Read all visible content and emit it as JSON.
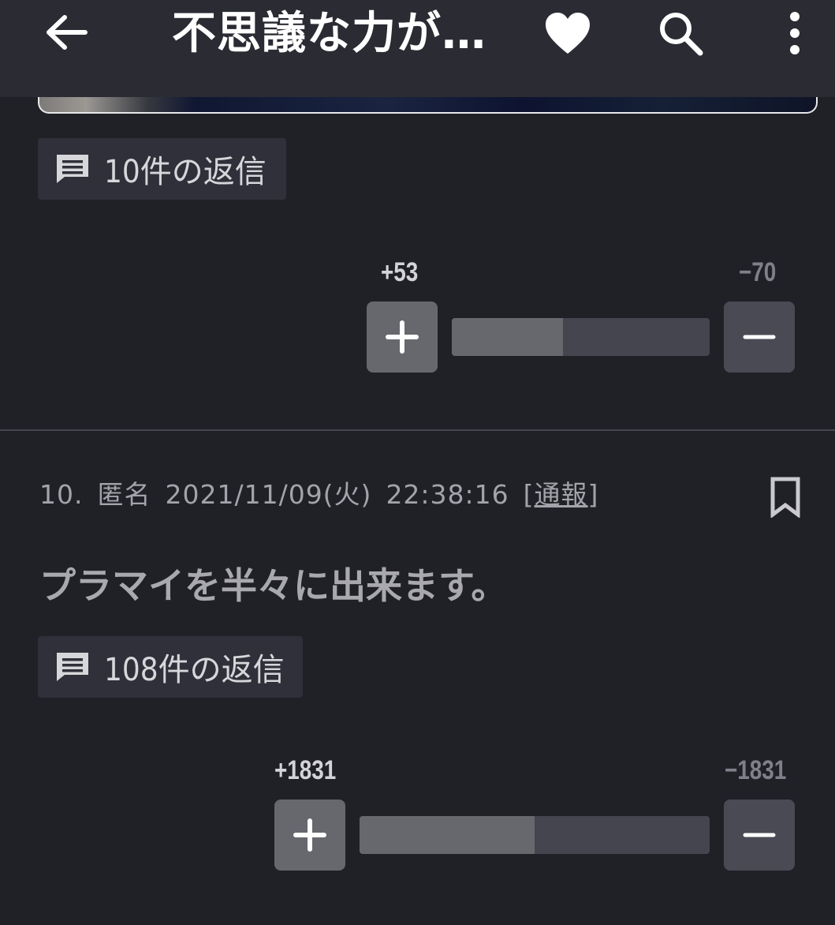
{
  "header": {
    "title": "不思議な力が…",
    "icons": [
      "arrow-back-icon",
      "heart-icon",
      "search-icon",
      "more-vert-icon"
    ],
    "background": "#2a2b33"
  },
  "comments": [
    {
      "replies_label": "10件の返信",
      "plus_count": "+53",
      "minus_count": "−70",
      "plus_share": 0.43
    },
    {
      "number": "10.",
      "author": "匿名",
      "date": "2021/11/09(火)",
      "time": "22:38:16",
      "report_label": "通報",
      "report_open": "[",
      "report_close": "]",
      "body": "プラマイを半々に出来ます。",
      "replies_label": "108件の返信",
      "plus_count": "+1831",
      "minus_count": "−1831",
      "plus_share": 0.5
    }
  ],
  "colors": {
    "background": "#202027",
    "chip": "#2f3039",
    "plus_button": "#67686e",
    "minus_button": "#4a4a55",
    "divider": "#45464d"
  }
}
